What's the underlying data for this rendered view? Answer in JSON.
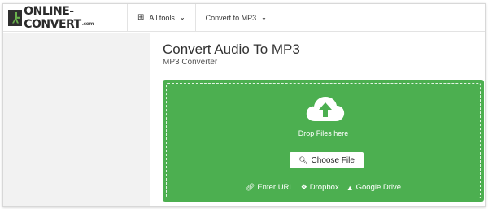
{
  "header": {
    "logo_text": "ONLINE-CONVERT",
    "logo_suffix": ".com",
    "all_tools_label": "All tools",
    "convert_label": "Convert to MP3"
  },
  "main": {
    "title": "Convert Audio To MP3",
    "subtitle": "MP3 Converter"
  },
  "dropzone": {
    "drop_text": "Drop Files here",
    "choose_label": "Choose File",
    "links": [
      {
        "label": "Enter URL",
        "icon": "link-icon"
      },
      {
        "label": "Dropbox",
        "icon": "dropbox-icon"
      },
      {
        "label": "Google Drive",
        "icon": "google-drive-icon"
      }
    ],
    "color": "#4caf50"
  }
}
